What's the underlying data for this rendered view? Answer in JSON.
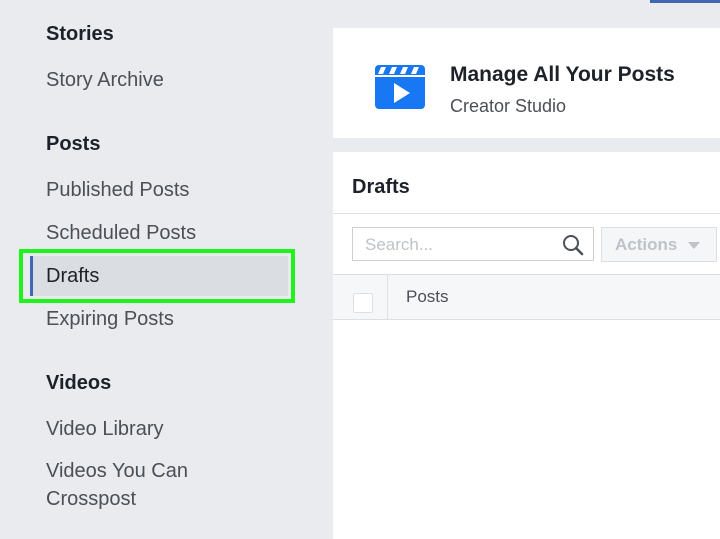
{
  "sidebar": {
    "sections": [
      {
        "heading": "Stories",
        "items": [
          "Story Archive"
        ]
      },
      {
        "heading": "Posts",
        "items": [
          "Published Posts",
          "Scheduled Posts",
          "Drafts",
          "Expiring Posts"
        ]
      },
      {
        "heading": "Videos",
        "items": [
          "Video Library",
          "Videos You Can",
          "Crosspost"
        ]
      }
    ],
    "selected": "Drafts",
    "highlight_color": "#1ef31e"
  },
  "creator_studio": {
    "title": "Manage All Your Posts",
    "subtitle": "Creator Studio",
    "icon": "clapperboard-play-icon",
    "icon_color": "#1877f2"
  },
  "drafts_panel": {
    "title": "Drafts",
    "search_placeholder": "Search...",
    "actions_label": "Actions",
    "columns": [
      "Posts"
    ]
  },
  "colors": {
    "accent": "#4267b2",
    "background": "#e9ebee"
  }
}
